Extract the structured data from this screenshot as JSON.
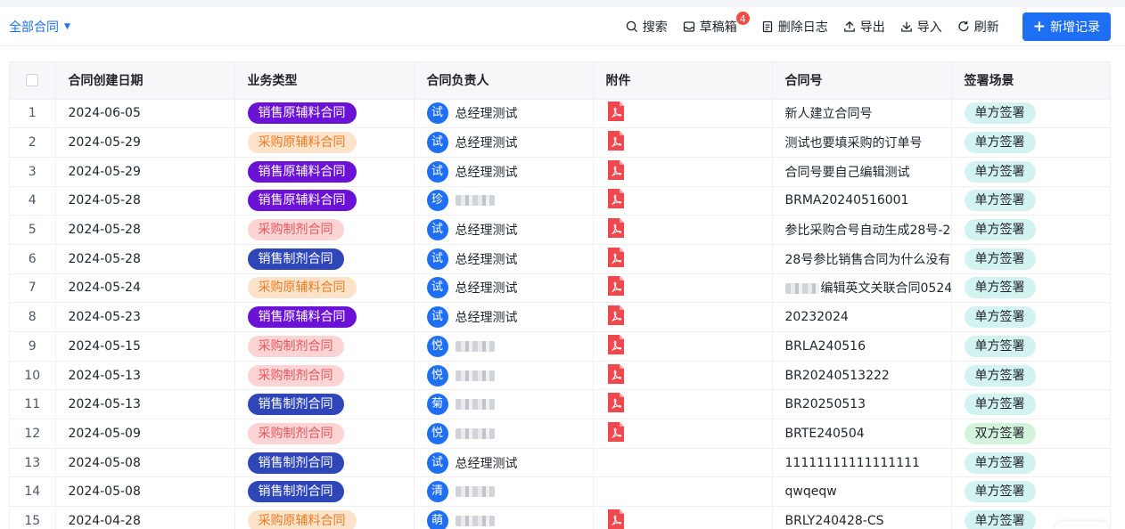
{
  "view": {
    "label": "全部合同"
  },
  "toolbar": {
    "search": "搜索",
    "drafts": "草稿箱",
    "drafts_count": "4",
    "delete_log": "删除日志",
    "export": "导出",
    "import": "导入",
    "refresh": "刷新",
    "add": "新增记录"
  },
  "colors": {
    "accent": "#1f6ff5",
    "sales_raw": "#6b12d6",
    "sales_agent": "#2e46b8",
    "purchase_raw": "#fde3c9",
    "purchase_agent": "#fcd4d4"
  },
  "table": {
    "headers": [
      "合同创建日期",
      "业务类型",
      "合同负责人",
      "附件",
      "合同号",
      "签署场景"
    ],
    "rows": [
      {
        "no": "1",
        "date": "2024-06-05",
        "type": "销售原辅料合同",
        "type_style": "a",
        "avatar": "试",
        "owner": "总经理测试",
        "pdf": true,
        "contract": "新人建立合同号",
        "scene": "单方签署",
        "scene_style": "single"
      },
      {
        "no": "2",
        "date": "2024-05-29",
        "type": "采购原辅料合同",
        "type_style": "b",
        "avatar": "试",
        "owner": "总经理测试",
        "pdf": true,
        "contract": "测试也要填采购的订单号",
        "scene": "单方签署",
        "scene_style": "single"
      },
      {
        "no": "3",
        "date": "2024-05-29",
        "type": "销售原辅料合同",
        "type_style": "a",
        "avatar": "试",
        "owner": "总经理测试",
        "pdf": true,
        "contract": "合同号要自己编辑测试",
        "scene": "单方签署",
        "scene_style": "single"
      },
      {
        "no": "4",
        "date": "2024-05-28",
        "type": "销售原辅料合同",
        "type_style": "a",
        "avatar": "珍",
        "owner": "",
        "pdf": true,
        "contract": "BRMA20240516001",
        "scene": "单方签署",
        "scene_style": "single"
      },
      {
        "no": "5",
        "date": "2024-05-28",
        "type": "采购制剂合同",
        "type_style": "c",
        "avatar": "试",
        "owner": "总经理测试",
        "pdf": true,
        "contract": "参比采购合号自动生成28号-2",
        "scene": "单方签署",
        "scene_style": "single"
      },
      {
        "no": "6",
        "date": "2024-05-28",
        "type": "销售制剂合同",
        "type_style": "d",
        "avatar": "试",
        "owner": "总经理测试",
        "pdf": true,
        "contract": "28号参比销售合同为什么没有",
        "scene": "单方签署",
        "scene_style": "single"
      },
      {
        "no": "7",
        "date": "2024-05-24",
        "type": "采购原辅料合同",
        "type_style": "b",
        "avatar": "试",
        "owner": "总经理测试",
        "pdf": true,
        "contract": "编辑英文关联合同0524",
        "contract_blur": true,
        "scene": "单方签署",
        "scene_style": "single"
      },
      {
        "no": "8",
        "date": "2024-05-23",
        "type": "销售原辅料合同",
        "type_style": "a",
        "avatar": "试",
        "owner": "总经理测试",
        "pdf": true,
        "contract": "20232024",
        "scene": "单方签署",
        "scene_style": "single"
      },
      {
        "no": "9",
        "date": "2024-05-15",
        "type": "采购制剂合同",
        "type_style": "c",
        "avatar": "悦",
        "owner": "",
        "pdf": true,
        "contract": "BRLA240516",
        "scene": "单方签署",
        "scene_style": "single"
      },
      {
        "no": "10",
        "date": "2024-05-13",
        "type": "采购制剂合同",
        "type_style": "c",
        "avatar": "悦",
        "owner": "",
        "pdf": true,
        "contract": "BR20240513222",
        "scene": "单方签署",
        "scene_style": "single"
      },
      {
        "no": "11",
        "date": "2024-05-13",
        "type": "销售制剂合同",
        "type_style": "d",
        "avatar": "菊",
        "owner": "",
        "pdf": true,
        "contract": "BR20250513",
        "scene": "单方签署",
        "scene_style": "single"
      },
      {
        "no": "12",
        "date": "2024-05-09",
        "type": "采购制剂合同",
        "type_style": "c",
        "avatar": "悦",
        "owner": "",
        "pdf": true,
        "contract": "BRTE240504",
        "scene": "双方签署",
        "scene_style": "double"
      },
      {
        "no": "13",
        "date": "2024-05-08",
        "type": "销售制剂合同",
        "type_style": "d",
        "avatar": "试",
        "owner": "总经理测试",
        "pdf": false,
        "contract": "11111111111111111",
        "scene": "单方签署",
        "scene_style": "single"
      },
      {
        "no": "14",
        "date": "2024-05-08",
        "type": "销售制剂合同",
        "type_style": "d",
        "avatar": "清",
        "owner": "",
        "pdf": false,
        "contract": "qwqeqw",
        "scene": "单方签署",
        "scene_style": "single"
      },
      {
        "no": "15",
        "date": "2024-04-28",
        "type": "采购原辅料合同",
        "type_style": "b",
        "avatar": "萌",
        "owner": "",
        "pdf": true,
        "contract": "BRLY240428-CS",
        "scene": "单方签署",
        "scene_style": "single"
      }
    ]
  }
}
